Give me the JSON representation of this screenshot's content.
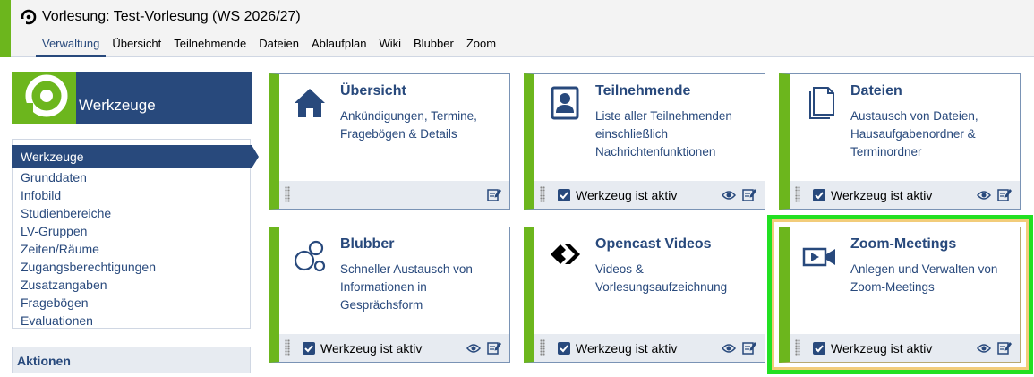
{
  "header": {
    "course_title": "Vorlesung: Test-Vorlesung (WS 2026/27)",
    "icon": "studip-logo-icon",
    "nav": [
      "Verwaltung",
      "Übersicht",
      "Teilnehmende",
      "Dateien",
      "Ablaufplan",
      "Wiki",
      "Blubber",
      "Zoom"
    ],
    "active_nav": "Verwaltung"
  },
  "sidebar": {
    "banner_title": "Werkzeuge",
    "active_item": "Werkzeuge",
    "items": [
      "Grunddaten",
      "Infobild",
      "Studienbereiche",
      "LV-Gruppen",
      "Zeiten/Räume",
      "Zugangsberechtigungen",
      "Zusatzangaben",
      "Fragebögen",
      "Evaluationen"
    ],
    "actions_title": "Aktionen"
  },
  "tiles": [
    {
      "title": "Übersicht",
      "description": "Ankündigungen, Termine, Fragebögen & Details",
      "icon": "house-icon",
      "active_label": "",
      "active": false
    },
    {
      "title": "Teilnehmende",
      "description": "Liste aller Teilnehmenden einschließlich Nachrichtenfunktionen",
      "icon": "person-card-icon",
      "active_label": "Werkzeug ist aktiv",
      "active": true
    },
    {
      "title": "Dateien",
      "description": "Austausch von Dateien, Hausaufgabenordner & Terminordner",
      "icon": "files-icon",
      "active_label": "Werkzeug ist aktiv",
      "active": true
    },
    {
      "title": "Blubber",
      "description": "Schneller Austausch von Informationen in Gesprächsform",
      "icon": "bubbles-icon",
      "active_label": "Werkzeug ist aktiv",
      "active": true
    },
    {
      "title": "Opencast Videos",
      "description": "Videos & Vorlesungsaufzeichnung",
      "icon": "opencast-icon",
      "active_label": "Werkzeug ist aktiv",
      "active": true
    },
    {
      "title": "Zoom-Meetings",
      "description": "Anlegen und Verwalten von Zoom-Meetings",
      "icon": "video-camera-icon",
      "active_label": "Werkzeug ist aktiv",
      "active": true
    }
  ],
  "colors": {
    "brand_blue": "#28497c",
    "brand_green": "#6cb61d",
    "highlight_green": "#22e022",
    "highlight_inner": "#f2cc7a"
  }
}
